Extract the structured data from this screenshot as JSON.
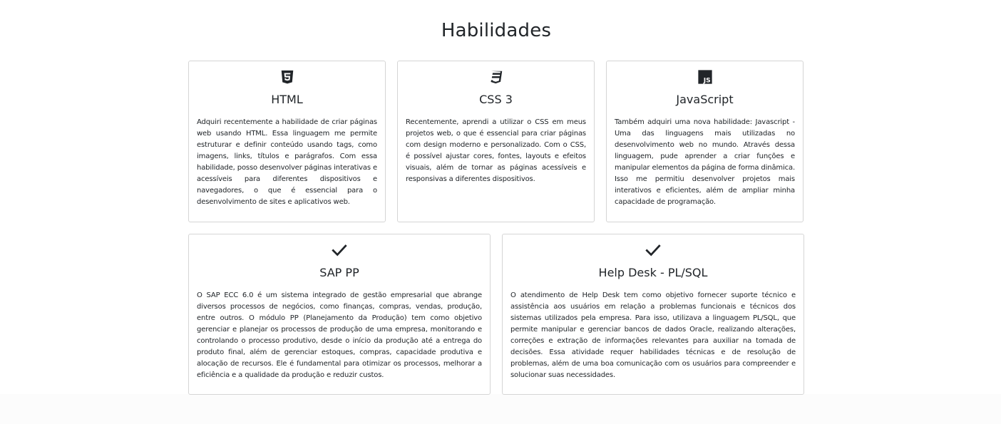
{
  "section": {
    "title": "Habilidades"
  },
  "cards": [
    {
      "icon": "html5-icon",
      "title": "HTML",
      "text": "Adquiri recentemente a habilidade de criar páginas web usando HTML. Essa linguagem me permite estruturar e definir conteúdo usando tags, como imagens, links, títulos e parágrafos. Com essa habilidade, posso desenvolver páginas interativas e acessíveis para diferentes dispositivos e navegadores, o que é essencial para o desenvolvimento de sites e aplicativos web."
    },
    {
      "icon": "css3-icon",
      "title": "CSS 3",
      "text": "Recentemente, aprendi a utilizar o CSS em meus projetos web, o que é essencial para criar páginas com design moderno e personalizado. Com o CSS, é possível ajustar cores, fontes, layouts e efeitos visuais, além de tornar as páginas acessíveis e responsivas a diferentes dispositivos."
    },
    {
      "icon": "javascript-icon",
      "title": "JavaScript",
      "text": "Também adquiri uma nova habilidade: Javascript - Uma das linguagens mais utilizadas no desenvolvimento web no mundo. Através dessa linguagem, pude aprender a criar funções e manipular elementos da página de forma dinâmica. Isso me permitiu desenvolver projetos mais interativos e eficientes, além de ampliar minha capacidade de programação."
    },
    {
      "icon": "check-icon",
      "title": "SAP PP",
      "text": "O SAP ECC 6.0 é um sistema integrado de gestão empresarial que abrange diversos processos de negócios, como finanças, compras, vendas, produção, entre outros. O módulo PP (Planejamento da Produção) tem como objetivo gerenciar e planejar os processos de produção de uma empresa, monitorando e controlando o processo produtivo, desde o início da produção até a entrega do produto final, além de gerenciar estoques, compras, capacidade produtiva e alocação de recursos. Ele é fundamental para otimizar os processos, melhorar a eficiência e a qualidade da produção e reduzir custos."
    },
    {
      "icon": "check-icon",
      "title": "Help Desk - PL/SQL",
      "text": "O atendimento de Help Desk tem como objetivo fornecer suporte técnico e assistência aos usuários em relação a problemas funcionais e técnicos dos sistemas utilizados pela empresa. Para isso, utilizava a linguagem PL/SQL, que permite manipular e gerenciar bancos de dados Oracle, realizando alterações, correções e extração de informações relevantes para auxiliar na tomada de decisões. Essa atividade requer habilidades técnicas e de resolução de problemas, além de uma boa comunicação com os usuários para compreender e solucionar suas necessidades."
    }
  ],
  "colors": {
    "text": "#212529",
    "border": "#d5d5d5",
    "background": "#ffffff"
  }
}
